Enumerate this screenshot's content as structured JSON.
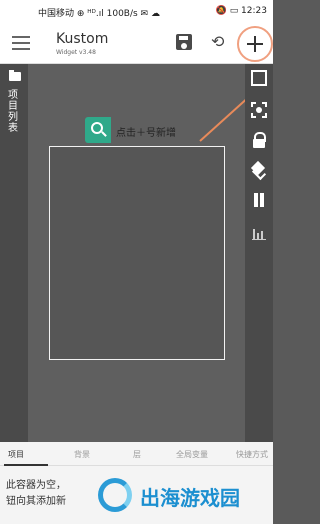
{
  "status_bar": {
    "left": "中国移动 ⊕ ᴴᴰ.ıl 100B/s ✉ ☁",
    "right": "🔕 ▭ 12:23"
  },
  "app_bar": {
    "title": "Kustom",
    "version": "Widget v3.48"
  },
  "sidebar": {
    "folder_label": "项目列表"
  },
  "hint": {
    "text": "点击＋号新增"
  },
  "tabs": [
    "项目",
    "背景",
    "层",
    "全局变量",
    "快捷方式"
  ],
  "bottom_panel": {
    "line1": "此容器为空，",
    "line2": "钮向其添加新"
  },
  "watermark": {
    "text": "出海游戏园"
  },
  "colors": {
    "accent_green": "#2fa98a",
    "arrow_orange": "#e88a5a",
    "watermark_blue": "#1c8fd0"
  }
}
